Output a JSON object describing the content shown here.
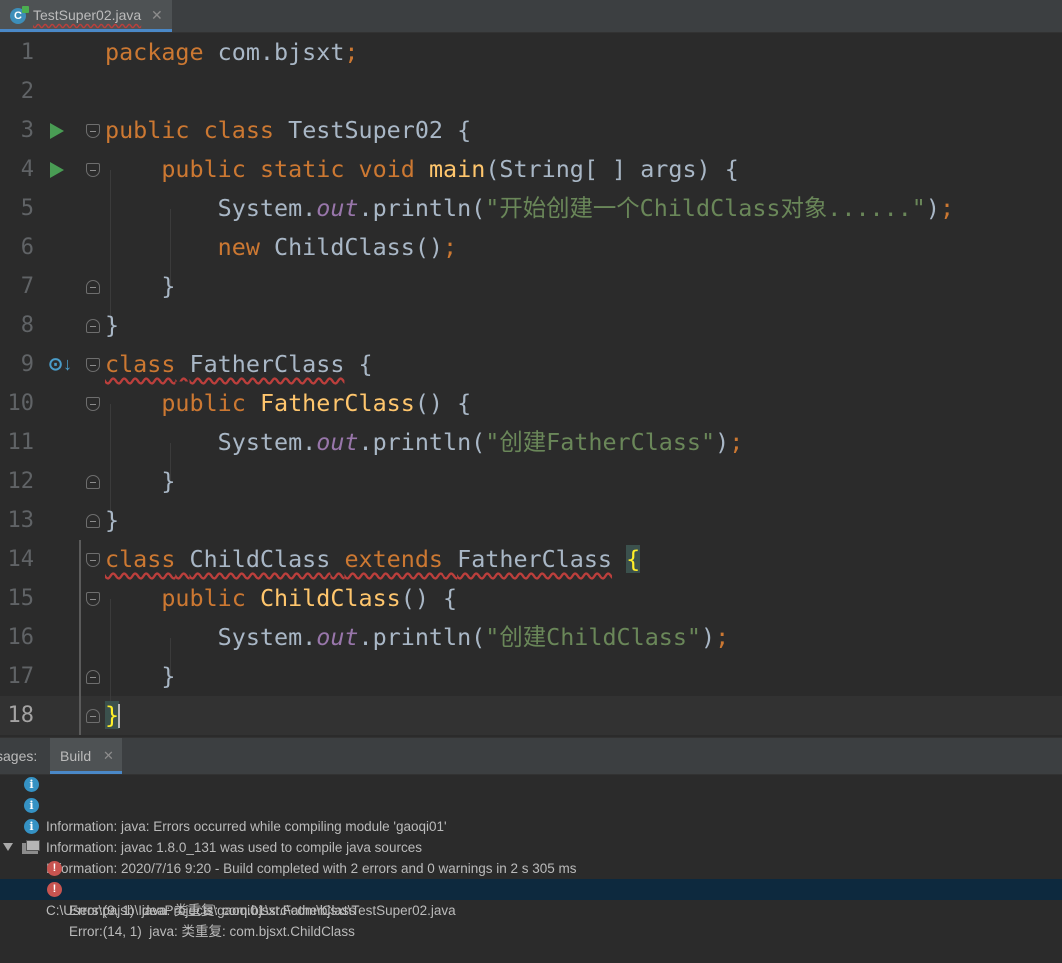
{
  "tab": {
    "icon": "C",
    "label": "TestSuper02.java",
    "close": "✕"
  },
  "editor": {
    "line_numbers": [
      "1",
      "2",
      "3",
      "4",
      "5",
      "6",
      "7",
      "8",
      "9",
      "10",
      "11",
      "12",
      "13",
      "14",
      "15",
      "16",
      "17",
      "18"
    ],
    "current_line": "18"
  },
  "code": {
    "l1_kw": "package",
    "l1_rest": " com.bjsxt",
    "l1_semi": ";",
    "l3_kw1": "public",
    "l3_kw2": "class",
    "l3_name": "TestSuper02",
    "l3_brace": "{",
    "l4_kw1": "public",
    "l4_kw2": "static",
    "l4_kw3": "void",
    "l4_fn": "main",
    "l4_params": "(String[ ] args) {",
    "l5_obj": "System.",
    "l5_fld": "out",
    "l5_call": ".println(",
    "l5_str": "\"开始创建一个ChildClass对象......\"",
    "l5_end": ")",
    "l5_semi": ";",
    "l6_kw": "new",
    "l6_rest": "ChildClass()",
    "l6_semi": ";",
    "l7": "}",
    "l8": "}",
    "l9_kw": "class",
    "l9_name": "FatherClass",
    "l9_brace": "{",
    "l10_kw": "public",
    "l10_fn": "FatherClass",
    "l10_rest": "() {",
    "l11_obj": "System.",
    "l11_fld": "out",
    "l11_call": ".println(",
    "l11_str": "\"创建FatherClass\"",
    "l11_end": ")",
    "l11_semi": ";",
    "l12": "}",
    "l13": "}",
    "l14_kw1": "class",
    "l14_name": "ChildClass",
    "l14_kw2": "extends",
    "l14_parent": "FatherClass",
    "l14_brace": "{",
    "l15_kw": "public",
    "l15_fn": "ChildClass",
    "l15_rest": "() {",
    "l16_obj": "System.",
    "l16_fld": "out",
    "l16_call": ".println(",
    "l16_str": "\"创建ChildClass\"",
    "l16_end": ")",
    "l16_semi": ";",
    "l17": "}",
    "l18": "}"
  },
  "panel": {
    "title": "sages:",
    "tab_label": "Build",
    "tab_close": "✕",
    "messages": [
      {
        "text": "Information: java: Errors occurred while compiling module 'gaoqi01'"
      },
      {
        "text": "Information: javac 1.8.0_131 was used to compile java sources"
      },
      {
        "text": "Information: 2020/7/16 9:20 - Build completed with 2 errors and 0 warnings in 2 s 305 ms"
      },
      {
        "text": "C:\\Users\\pajsb\\IdeaProjects\\gaoqi01\\src\\com\\bjsxt\\TestSuper02.java"
      },
      {
        "text": "Error:(9, 1)  java: 类重复: com.bjsxt.FatherClass"
      },
      {
        "text": "Error:(14, 1)  java: 类重复: com.bjsxt.ChildClass"
      }
    ]
  },
  "icons": {
    "run": "run-gutter-icon",
    "override": "overridden-method-icon",
    "info": "info-icon",
    "error": "error-icon"
  },
  "colors": {
    "background": "#2b2b2b",
    "keyword": "#cc7832",
    "string": "#6a8759",
    "function": "#ffc66d",
    "field": "#9876aa",
    "text": "#a9b7c6",
    "error_underline": "#bc3f3c"
  }
}
